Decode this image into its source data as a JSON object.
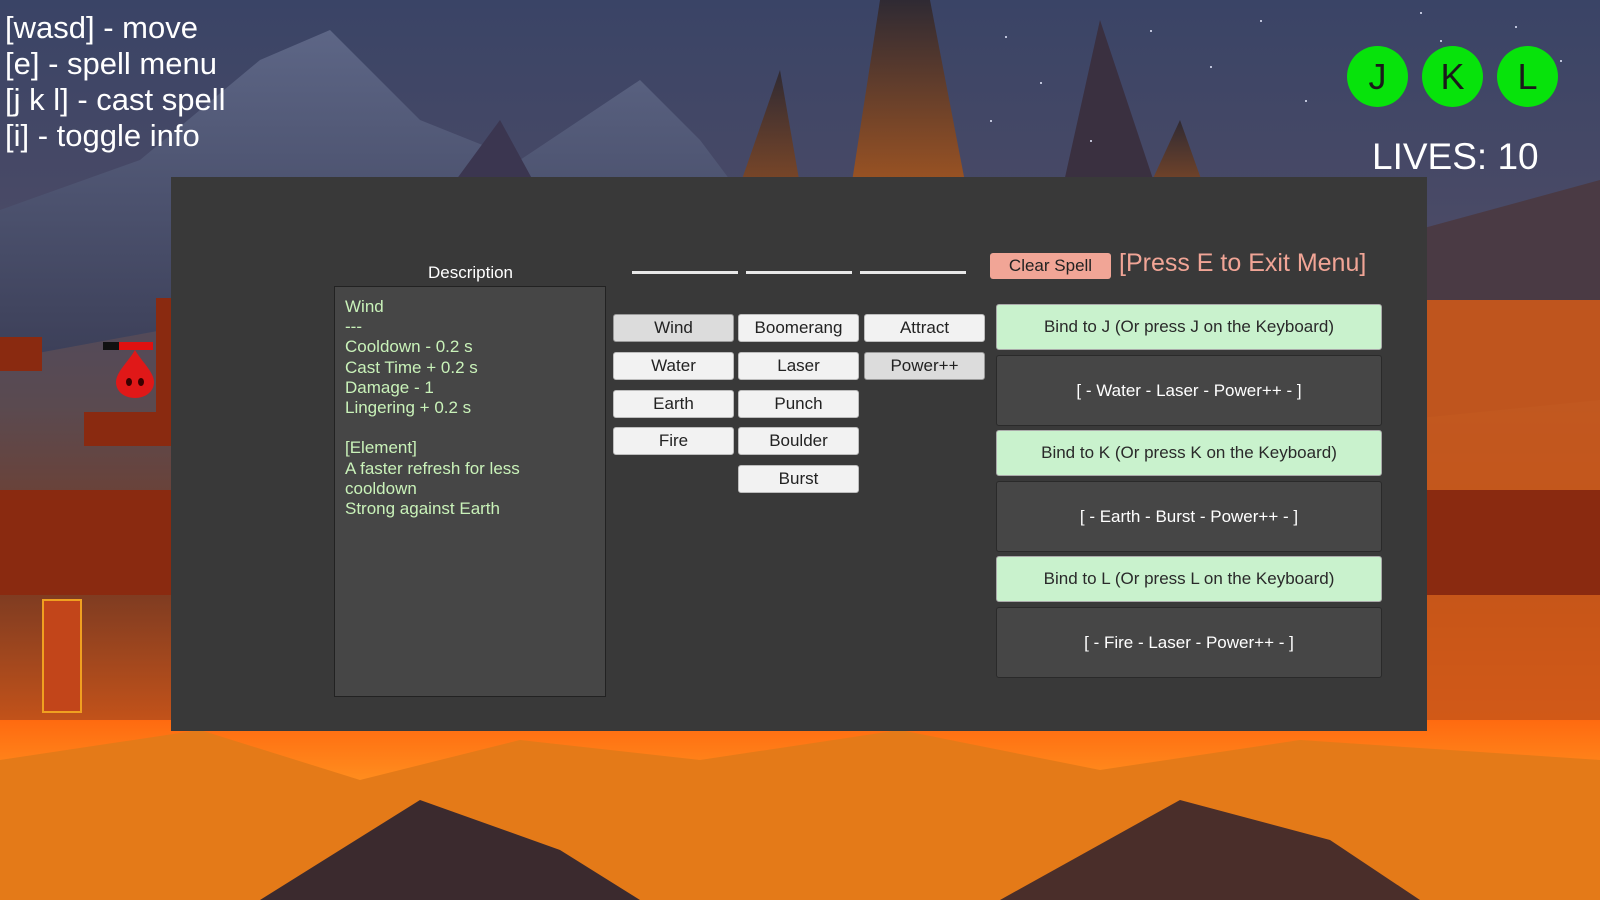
{
  "hud": {
    "controls": [
      "[wasd] - move",
      "[e] - spell menu",
      "[j k l] - cast spell",
      "[i] - toggle info"
    ],
    "spell_keys": [
      "J",
      "K",
      "L"
    ],
    "lives_text": "LIVES: 10"
  },
  "description": {
    "title": "Description",
    "lines": [
      "Wind",
      "---",
      "Cooldown - 0.2 s",
      "Cast Time + 0.2 s",
      "Damage - 1",
      "Lingering + 0.2 s",
      "",
      "[Element]",
      "A faster refresh for less",
      "cooldown",
      "Strong against Earth"
    ]
  },
  "spells": {
    "column1": [
      "Wind",
      "Water",
      "Earth",
      "Fire"
    ],
    "column2": [
      "Boomerang",
      "Laser",
      "Punch",
      "Boulder",
      "Burst"
    ],
    "column3": [
      "Attract",
      "Power++"
    ]
  },
  "clear_label": "Clear Spell",
  "exit_label": "[Press E to Exit Menu]",
  "bindings": [
    {
      "label": "Bind to J (Or press J on the Keyboard)",
      "combo": "[ - Water - Laser - Power++ - ]"
    },
    {
      "label": "Bind to K (Or press K on the Keyboard)",
      "combo": "[ - Earth - Burst - Power++ - ]"
    },
    {
      "label": "Bind to L (Or press L on the Keyboard)",
      "combo": "[ - Fire - Laser - Power++ - ]"
    }
  ],
  "colors": {
    "key_circle": "#07e30b",
    "clear_button": "#f1a596",
    "bind_button": "#c9f2cd",
    "description_text": "#c9f2b9",
    "panel": "#393939"
  }
}
